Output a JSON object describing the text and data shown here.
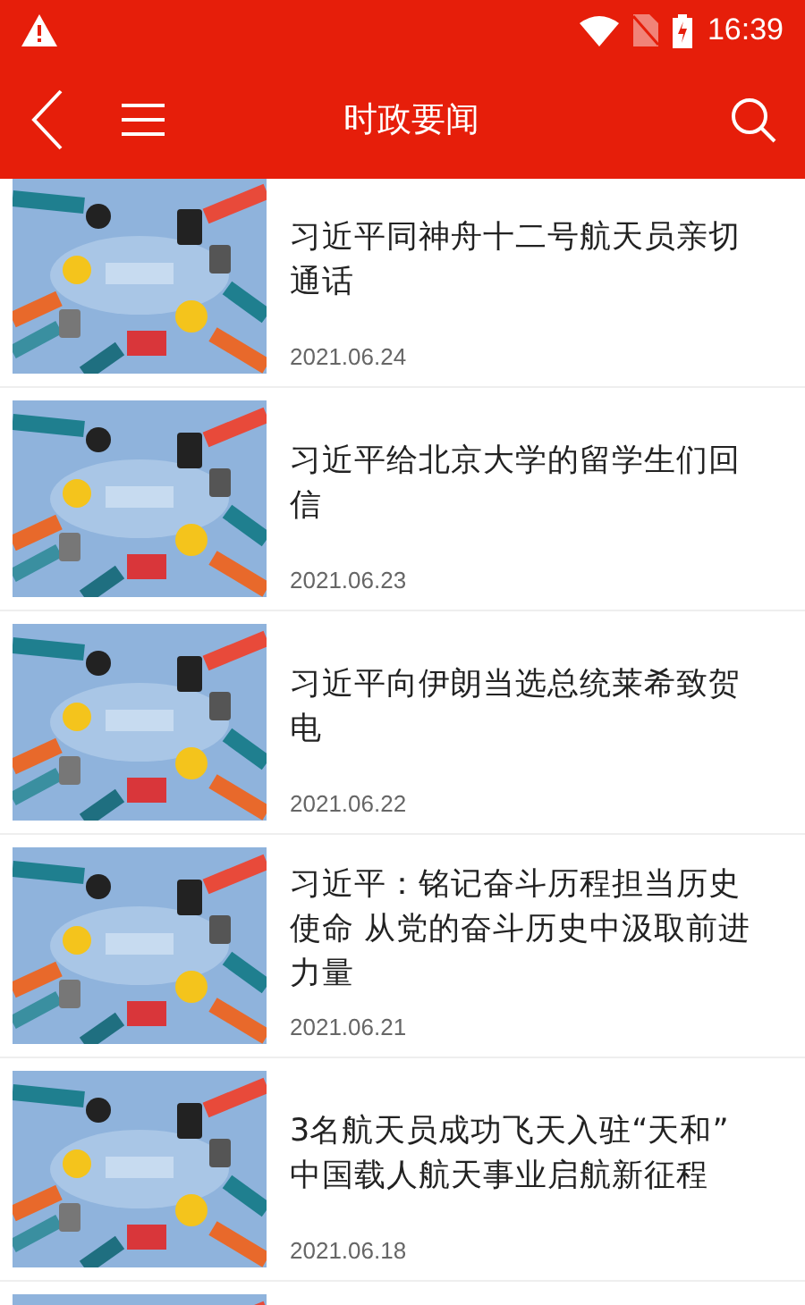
{
  "status_bar": {
    "time": "16:39"
  },
  "toolbar": {
    "title": "时政要闻"
  },
  "news": [
    {
      "title": "习近平同神舟十二号航天员亲切通话",
      "date": "2021.06.24"
    },
    {
      "title": "习近平给北京大学的留学生们回信",
      "date": "2021.06.23"
    },
    {
      "title": "习近平向伊朗当选总统莱希致贺电",
      "date": "2021.06.22"
    },
    {
      "title": "习近平：铭记奋斗历程担当历史使命 从党的奋斗历史中汲取前进力量",
      "date": "2021.06.21"
    },
    {
      "title": "3名航天员成功飞天入驻“天和” 中国载人航天事业启航新征程",
      "date": "2021.06.18"
    }
  ]
}
